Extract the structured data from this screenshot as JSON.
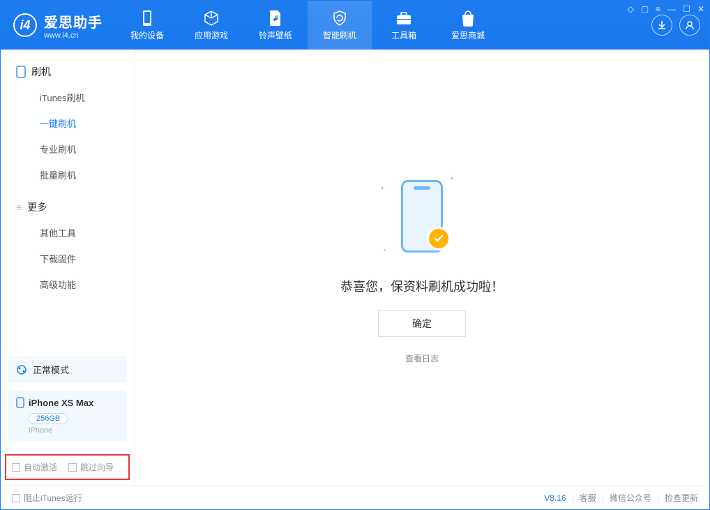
{
  "app": {
    "name_cn": "爱思助手",
    "url": "www.i4.cn"
  },
  "nav": {
    "items": [
      {
        "label": "我的设备"
      },
      {
        "label": "应用游戏"
      },
      {
        "label": "铃声壁纸"
      },
      {
        "label": "智能刷机"
      },
      {
        "label": "工具箱"
      },
      {
        "label": "爱思商城"
      }
    ]
  },
  "sidebar": {
    "group_flash": "刷机",
    "flash_items": [
      "iTunes刷机",
      "一键刷机",
      "专业刷机",
      "批量刷机"
    ],
    "group_more": "更多",
    "more_items": [
      "其他工具",
      "下载固件",
      "高级功能"
    ],
    "mode": "正常模式",
    "device": {
      "name": "iPhone XS Max",
      "storage": "256GB",
      "type": "iPhone"
    },
    "checkboxes": {
      "auto_activate": "自动激活",
      "skip_guide": "跳过向导"
    }
  },
  "main": {
    "success_text": "恭喜您，保资料刷机成功啦！",
    "ok_label": "确定",
    "log_link": "查看日志"
  },
  "footer": {
    "block_itunes": "阻止iTunes运行",
    "version": "V8.16",
    "links": [
      "客服",
      "微信公众号",
      "检查更新"
    ]
  }
}
